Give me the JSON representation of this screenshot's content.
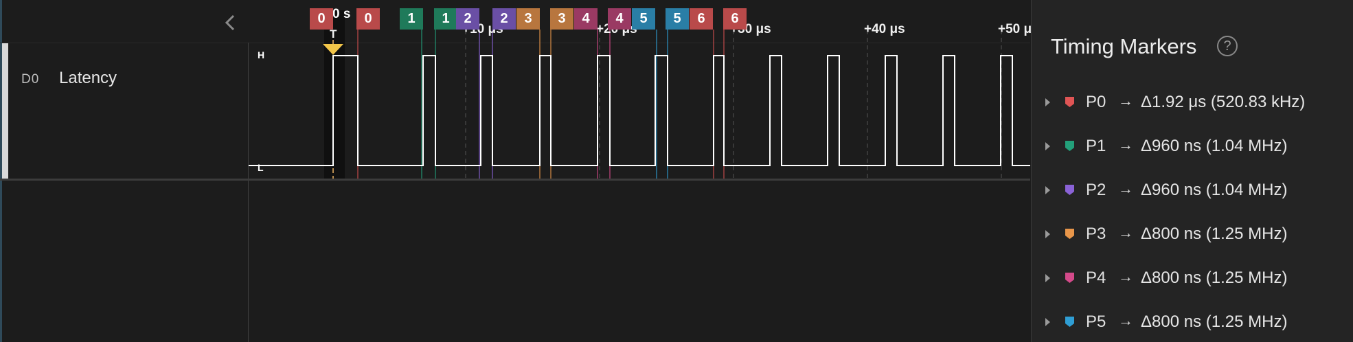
{
  "analyzer": {
    "collapse_icon": "chevron-left-icon",
    "time_origin_label": "0 s",
    "time_labels": [
      "+10 μs",
      "+20 μs",
      "+30 μs",
      "+40 μs",
      "+50 μ"
    ],
    "channel": {
      "id": "D0",
      "name": "Latency",
      "level_high": "H",
      "level_low": "L"
    },
    "trigger_marker_label": "T",
    "marker_tags": [
      {
        "label": "0",
        "color": "#b94a4a"
      },
      {
        "label": "0",
        "color": "#b94a4a"
      },
      {
        "label": "1",
        "color": "#1f7a5a"
      },
      {
        "label": "1",
        "color": "#1f7a5a"
      },
      {
        "label": "2",
        "color": "#6a4fa5"
      },
      {
        "label": "2",
        "color": "#6a4fa5"
      },
      {
        "label": "3",
        "color": "#b8763e"
      },
      {
        "label": "3",
        "color": "#b8763e"
      },
      {
        "label": "4",
        "color": "#9a3a63"
      },
      {
        "label": "4",
        "color": "#9a3a63"
      },
      {
        "label": "5",
        "color": "#2a7ea6"
      },
      {
        "label": "5",
        "color": "#2a7ea6"
      },
      {
        "label": "6",
        "color": "#b94a4a"
      },
      {
        "label": "6",
        "color": "#b94a4a"
      }
    ]
  },
  "timing_markers": {
    "title": "Timing Markers",
    "help_icon": "question-circle-icon",
    "items": [
      {
        "name": "P0",
        "arrow": "→",
        "value": "Δ1.92 μs (520.83 kHz)",
        "color": "#e05555"
      },
      {
        "name": "P1",
        "arrow": "→",
        "value": "Δ960 ns (1.04 MHz)",
        "color": "#23a07a"
      },
      {
        "name": "P2",
        "arrow": "→",
        "value": "Δ960 ns (1.04 MHz)",
        "color": "#8a62d6"
      },
      {
        "name": "P3",
        "arrow": "→",
        "value": "Δ800 ns (1.25 MHz)",
        "color": "#e8964a"
      },
      {
        "name": "P4",
        "arrow": "→",
        "value": "Δ800 ns (1.25 MHz)",
        "color": "#d44a8a"
      },
      {
        "name": "P5",
        "arrow": "→",
        "value": "Δ800 ns (1.25 MHz)",
        "color": "#2f9ed4"
      }
    ]
  }
}
